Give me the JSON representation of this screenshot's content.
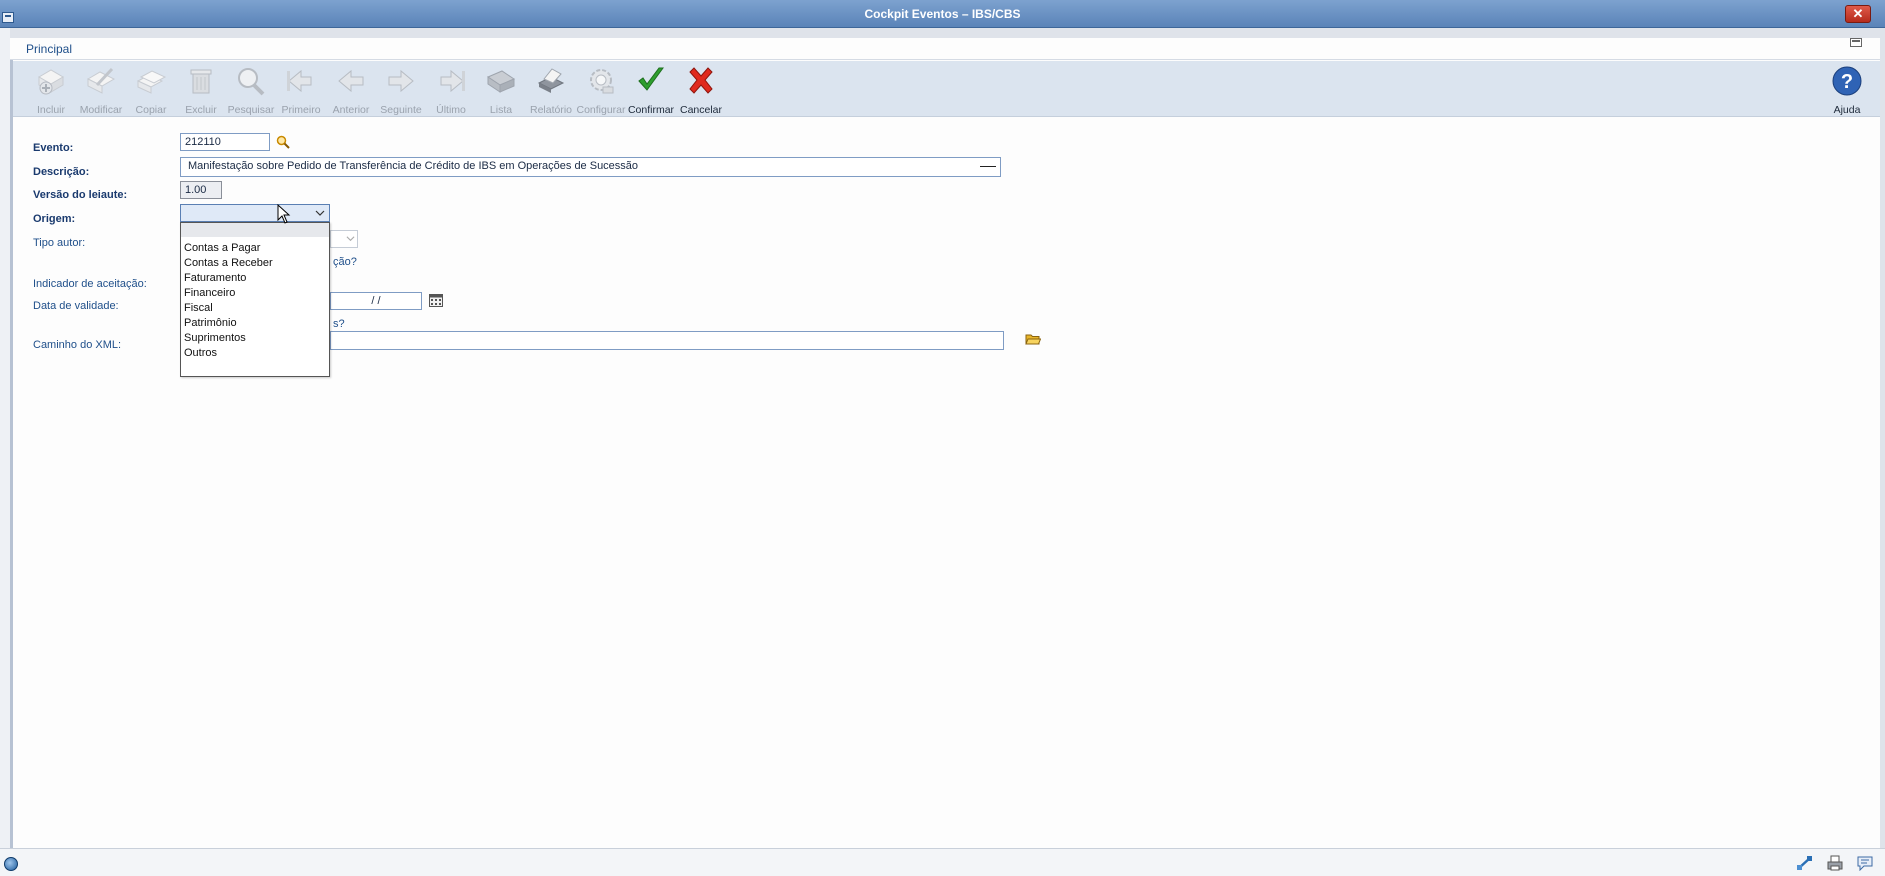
{
  "window": {
    "title": "Cockpit Eventos – IBS/CBS",
    "close_label": "✕"
  },
  "panel": {
    "title": "Principal"
  },
  "toolbar": {
    "buttons": [
      {
        "label": "Incluir",
        "key": "I"
      },
      {
        "label": "Modificar",
        "key": "M"
      },
      {
        "label": "Copiar",
        "key": "o"
      },
      {
        "label": "Excluir",
        "key": "E"
      },
      {
        "label": "Pesquisar",
        "key": "P"
      },
      {
        "label": "Primeiro",
        "key": "r"
      },
      {
        "label": "Anterior",
        "key": "A"
      },
      {
        "label": "Seguinte",
        "key": "S"
      },
      {
        "label": "Último",
        "key": "Ú"
      },
      {
        "label": "Lista",
        "key": "L"
      },
      {
        "label": "Relatório",
        "key": ""
      },
      {
        "label": "Configurar",
        "key": ""
      },
      {
        "label": "Confirmar",
        "key": ""
      },
      {
        "label": "Cancelar",
        "key": ""
      },
      {
        "label": "Ajuda",
        "key": ""
      }
    ]
  },
  "form": {
    "evento_label": "Evento:",
    "evento_value": "212110",
    "descricao_label": "Descrição:",
    "descricao_value": "Manifestação sobre Pedido de Transferência de Crédito de IBS em Operações de Sucessão",
    "versao_label": "Versão do leiaute:",
    "versao_value": "1.00",
    "origem_label": "Origem:",
    "origem_value": "",
    "tipo_autor_label": "Tipo autor:",
    "partial_question_1": "ção?",
    "indicador_label": "Indicador de aceitação:",
    "data_validade_label": "Data de validade:",
    "data_validade_value": "/ /",
    "partial_question_2": "s?",
    "caminho_label": "Caminho do XML:",
    "caminho_value": ""
  },
  "origem_dropdown": {
    "options": [
      "Contas a Pagar",
      "Contas a Receber",
      "Faturamento",
      "Financeiro",
      "Fiscal",
      "Patrimônio",
      "Suprimentos",
      "Outros"
    ]
  },
  "icons": {
    "search": "magnifier-icon",
    "calendar": "calendar-icon",
    "folder": "folder-open-icon"
  }
}
